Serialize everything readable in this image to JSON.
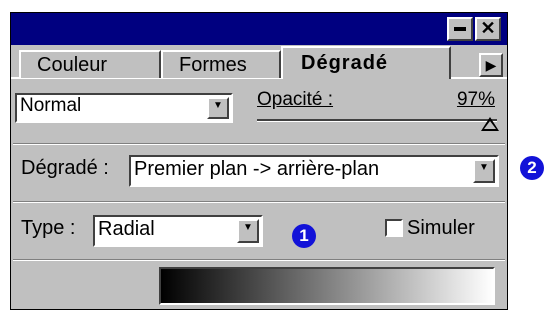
{
  "window": {
    "titlebar_buttons": [
      "minimize-icon",
      "close-icon"
    ],
    "close_glyph": "✕"
  },
  "tabs": [
    {
      "label": "Couleur",
      "active": false
    },
    {
      "label": "Formes",
      "active": false
    },
    {
      "label": "Dégradé",
      "active": true
    }
  ],
  "tab_scroll_glyph": "▶",
  "blend": {
    "mode_value": "Normal",
    "dropdown_glyph": "▼"
  },
  "opacity": {
    "label": "Opacité :",
    "value": "97%",
    "level_percent": 97
  },
  "gradient": {
    "label": "Dégradé :",
    "value": "Premier plan -> arrière-plan",
    "ramp_colors": [
      "#000000",
      "#ffffff"
    ]
  },
  "type": {
    "label": "Type :",
    "value": "Radial"
  },
  "simulate": {
    "label": "Simuler",
    "checked": false
  },
  "callouts": [
    "1",
    "2"
  ],
  "colors": {
    "titlebar": "#000080",
    "panel": "#c0c0c0",
    "callout": "#1212d8"
  }
}
